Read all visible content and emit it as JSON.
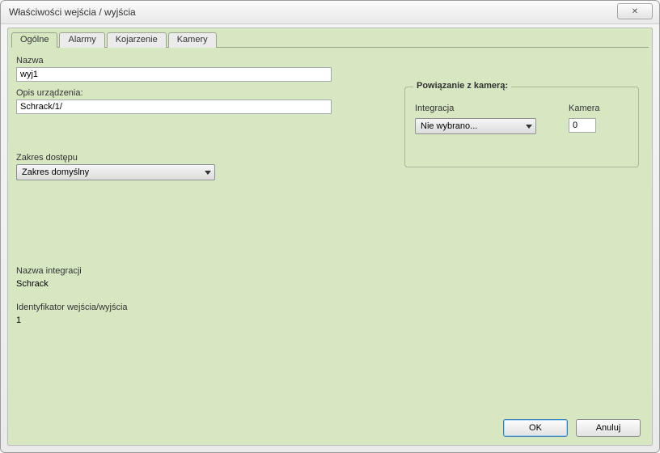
{
  "window": {
    "title": "Właściwości wejścia / wyjścia",
    "close_icon": "✕"
  },
  "tabs": {
    "general": "Ogólne",
    "alarms": "Alarmy",
    "association": "Kojarzenie",
    "cameras": "Kamery"
  },
  "labels": {
    "name": "Nazwa",
    "device_desc": "Opis urządzenia:",
    "access_scope": "Zakres dostępu",
    "integration_name": "Nazwa integracji",
    "io_identifier": "Identyfikator wejścia/wyjścia"
  },
  "fields": {
    "name_value": "wyj1",
    "device_desc_value": "Schrack/1/",
    "access_scope_value": "Zakres domyślny",
    "integration_name_value": "Schrack",
    "io_identifier_value": "1"
  },
  "camera_link": {
    "legend": "Powiązanie z kamerą:",
    "integration_label": "Integracja",
    "integration_value": "Nie wybrano...",
    "camera_label": "Kamera",
    "camera_value": "0"
  },
  "buttons": {
    "ok": "OK",
    "cancel": "Anuluj"
  }
}
